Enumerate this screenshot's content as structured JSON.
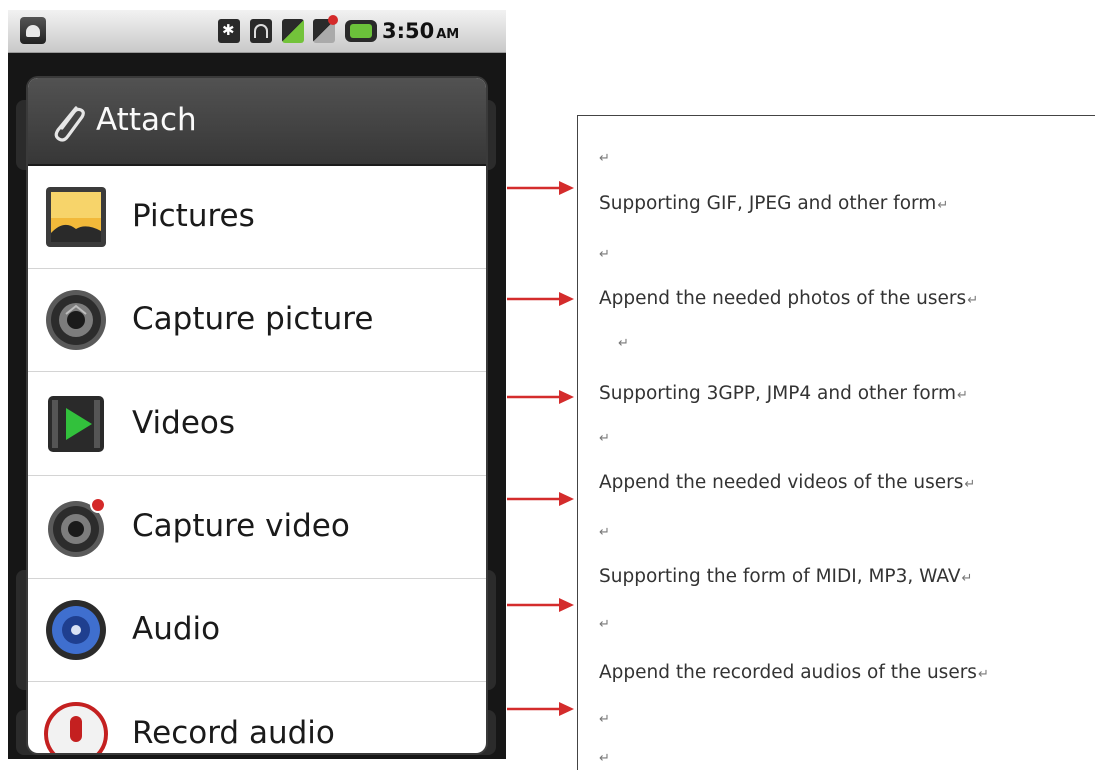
{
  "status_bar": {
    "time": "3:50",
    "ampm": "AM",
    "icons": [
      "android-icon",
      "bluetooth-icon",
      "wifi-icon",
      "signal-icon",
      "signal-no-sim-icon",
      "battery-charging-icon"
    ]
  },
  "dialog": {
    "title": "Attach",
    "title_icon": "paperclip-icon",
    "items": [
      {
        "label": "Pictures",
        "icon": "picture-icon"
      },
      {
        "label": "Capture picture",
        "icon": "camera-icon"
      },
      {
        "label": "Videos",
        "icon": "film-play-icon"
      },
      {
        "label": "Capture video",
        "icon": "video-camera-icon"
      },
      {
        "label": "Audio",
        "icon": "speaker-icon"
      },
      {
        "label": "Record audio",
        "icon": "microphone-icon"
      }
    ]
  },
  "document": {
    "return_mark": "↵",
    "lines": [
      "Supporting GIF, JPEG and other form",
      "Append the needed photos of the users",
      "Supporting 3GPP, JMP4 and other form",
      "Append the needed videos of the users",
      "Supporting the form of MIDI, MP3, WAV",
      "Append the recorded audios of the users"
    ]
  },
  "colors": {
    "arrow": "#d42c2c",
    "dialog_header": "#3f3f3f",
    "status_bar": "#dcdcdc"
  }
}
